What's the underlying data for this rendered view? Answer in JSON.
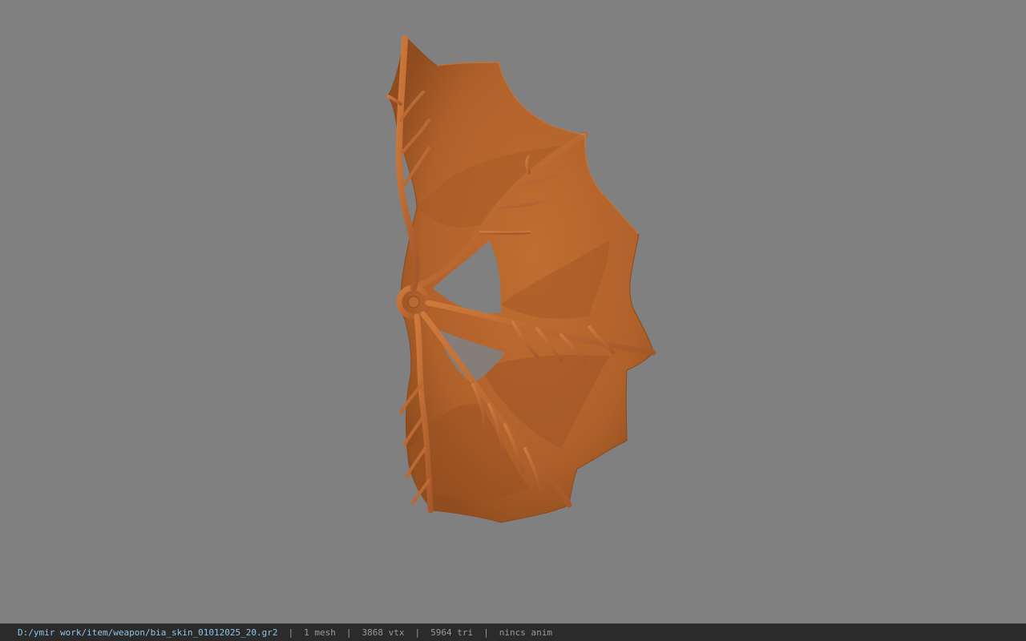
{
  "viewport": {
    "background_color": "#808080",
    "model_color": "#b8662c",
    "model_name": "leaf-shaped weapon skin mesh"
  },
  "statusbar": {
    "file_path": "D:/ymir work/item/weapon/bia_skin_01012025_20.gr2",
    "mesh_count": "1 mesh",
    "vertex_count": "3868 vtx",
    "triangle_count": "5964 tri",
    "anim_status": "nincs anim",
    "separator": "|"
  }
}
